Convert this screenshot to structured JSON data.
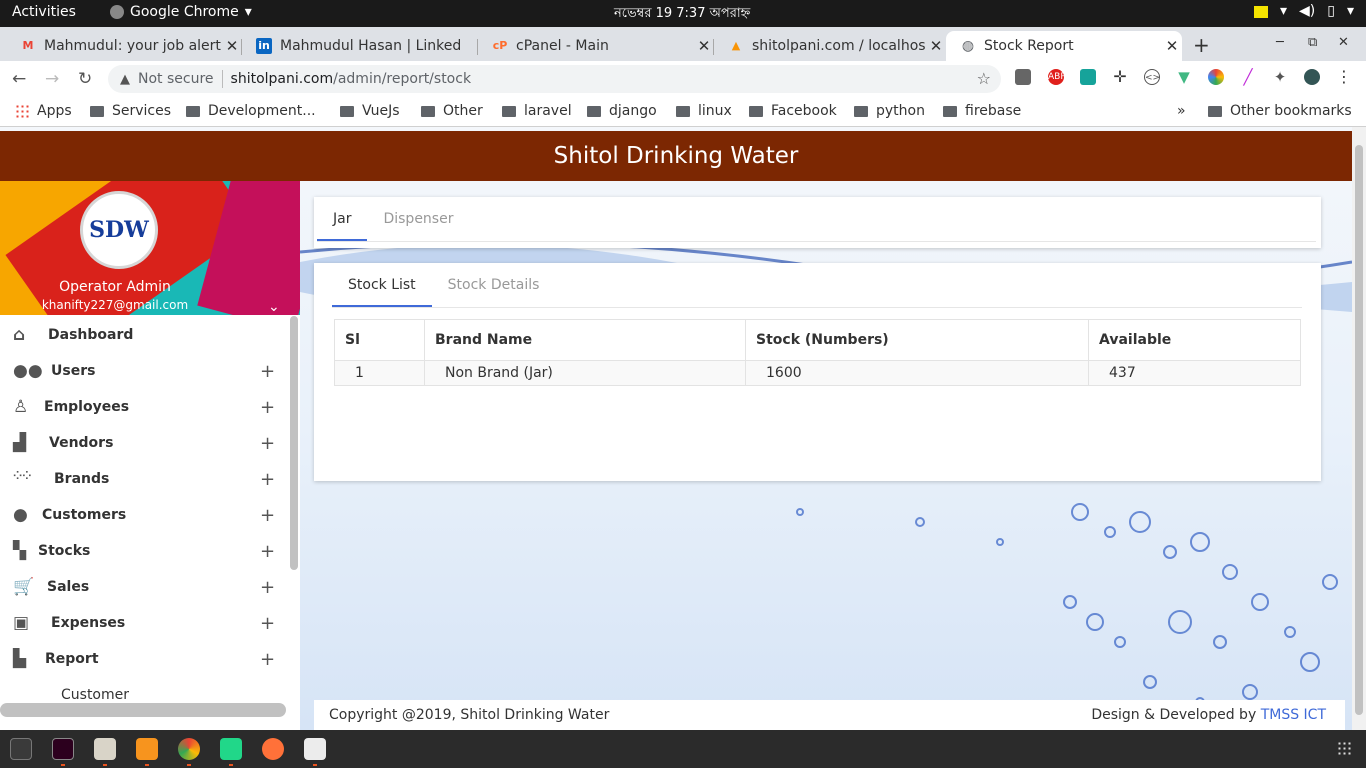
{
  "os": {
    "activities": "Activities",
    "app_name": "Google Chrome",
    "clock": "নভেম্বর 19  7:37 অপরাহ্ন"
  },
  "browser": {
    "tabs": [
      {
        "label": "Mahmudul: your job alert",
        "favicon": "gmail-icon",
        "active": false
      },
      {
        "label": "Mahmudul Hasan | Linked",
        "favicon": "linkedin-icon",
        "active": false
      },
      {
        "label": "cPanel - Main",
        "favicon": "cpanel-icon",
        "active": false
      },
      {
        "label": "shitolpani.com / localhos",
        "favicon": "phpmyadmin-icon",
        "active": false
      },
      {
        "label": "Stock Report",
        "favicon": "globe-icon",
        "active": true
      }
    ],
    "security": "Not secure",
    "url_domain": "shitolpani.com",
    "url_path": "/admin/report/stock",
    "bookmarks": [
      "Apps",
      "Services",
      "Development...",
      "VueJs",
      "Other",
      "laravel",
      "django",
      "linux",
      "Facebook",
      "python",
      "firebase"
    ],
    "overflow": "»",
    "other_bookmarks": "Other bookmarks"
  },
  "app": {
    "title": "Shitol Drinking Water",
    "logo_text": "SDW",
    "user": {
      "name": "Operator Admin",
      "email": "khanifty227@gmail.com"
    },
    "menu": [
      {
        "label": "Dashboard",
        "icon": "home-icon",
        "expandable": false
      },
      {
        "label": "Users",
        "icon": "users-icon",
        "expandable": true
      },
      {
        "label": "Employees",
        "icon": "employee-icon",
        "expandable": true
      },
      {
        "label": "Vendors",
        "icon": "factory-icon",
        "expandable": true
      },
      {
        "label": "Brands",
        "icon": "grid-dots-icon",
        "expandable": true
      },
      {
        "label": "Customers",
        "icon": "person-icon",
        "expandable": true
      },
      {
        "label": "Stocks",
        "icon": "cubes-icon",
        "expandable": true
      },
      {
        "label": "Sales",
        "icon": "cart-icon",
        "expandable": true
      },
      {
        "label": "Expenses",
        "icon": "money-icon",
        "expandable": true
      },
      {
        "label": "Report",
        "icon": "file-icon",
        "expandable": true
      }
    ],
    "submenu_visible": "Customer",
    "plus": "+",
    "type_tabs": [
      "Jar",
      "Dispenser"
    ],
    "view_tabs": [
      "Stock List",
      "Stock Details"
    ],
    "table": {
      "headers": [
        "Sl",
        "Brand Name",
        "Stock (Numbers)",
        "Available"
      ],
      "rows": [
        [
          "1",
          "Non Brand (Jar)",
          "1600",
          "437"
        ]
      ]
    },
    "footer_left": "Copyright @2019, Shitol Drinking Water",
    "footer_right_prefix": "Design & Developed by",
    "footer_right_link": "TMSS ICT"
  }
}
